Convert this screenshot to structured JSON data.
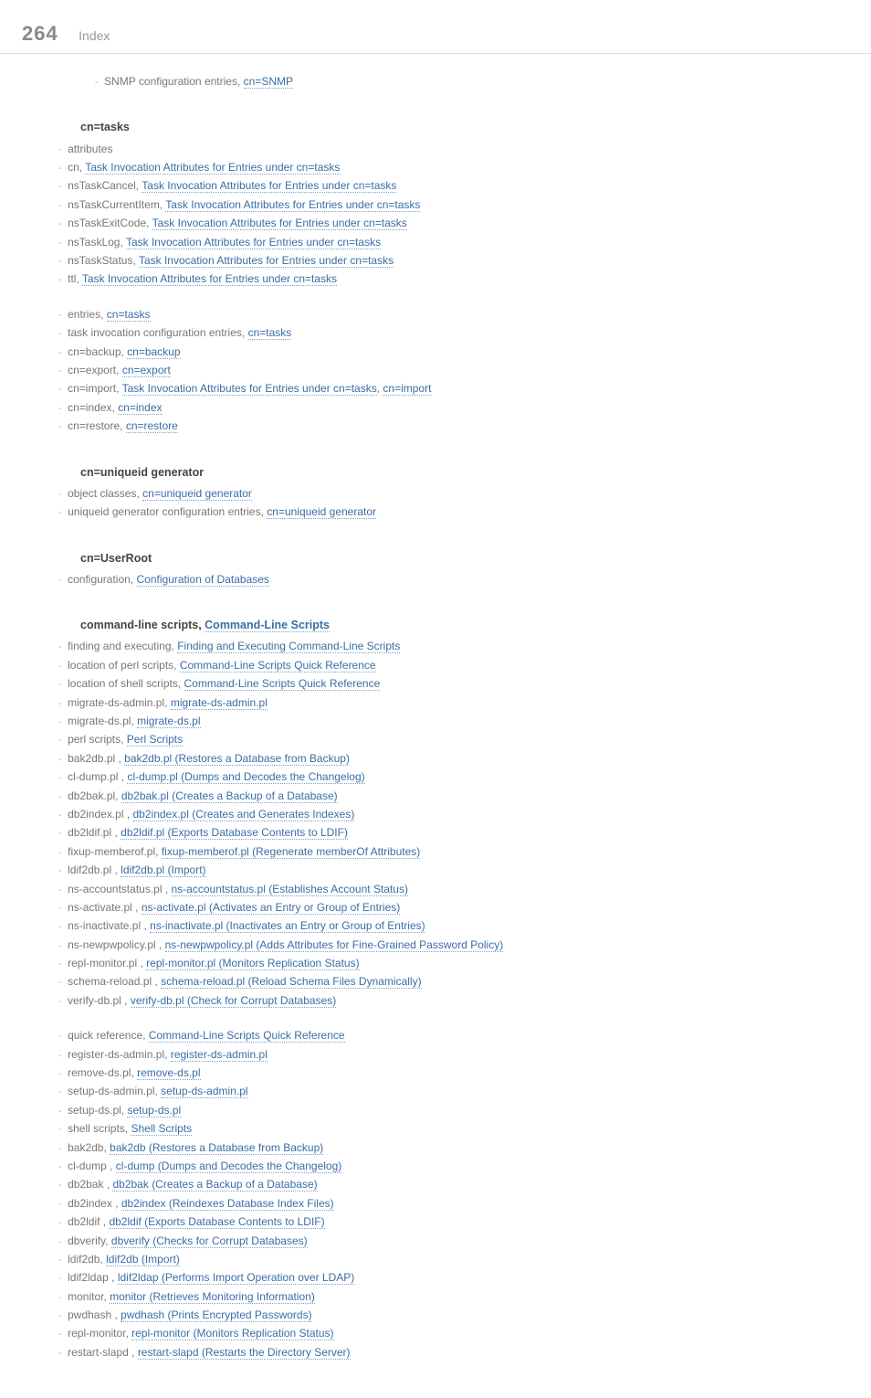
{
  "header": {
    "page_number": "264",
    "section": "Index"
  },
  "pre_section": {
    "items": [
      {
        "plain": "SNMP configuration entries, ",
        "link": "cn=SNMP"
      }
    ]
  },
  "sections": [
    {
      "title": "cn=tasks",
      "items": [
        {
          "lvl": 0,
          "plain": "attributes",
          "children": [
            {
              "plain": "cn, ",
              "link": "Task Invocation Attributes for Entries under cn=tasks"
            },
            {
              "plain": "nsTaskCancel, ",
              "link": "Task Invocation Attributes for Entries under cn=tasks"
            },
            {
              "plain": "nsTaskCurrentItem, ",
              "link": "Task Invocation Attributes for Entries under cn=tasks"
            },
            {
              "plain": "nsTaskExitCode, ",
              "link": "Task Invocation Attributes for Entries under cn=tasks"
            },
            {
              "plain": "nsTaskLog, ",
              "link": "Task Invocation Attributes for Entries under cn=tasks"
            },
            {
              "plain": "nsTaskStatus, ",
              "link": "Task Invocation Attributes for Entries under cn=tasks"
            },
            {
              "plain": "ttl, ",
              "link": "Task Invocation Attributes for Entries under cn=tasks"
            }
          ]
        },
        {
          "lvl": 0,
          "plain": "entries, ",
          "link": "cn=tasks",
          "gap_before": true
        },
        {
          "lvl": 0,
          "plain": "task invocation configuration entries, ",
          "link": "cn=tasks",
          "children": [
            {
              "plain": "cn=backup, ",
              "link": "cn=backup"
            },
            {
              "plain": "cn=export, ",
              "link": "cn=export"
            },
            {
              "plain": "cn=import, ",
              "link": "Task Invocation Attributes for Entries under cn=tasks",
              "sep2": ", ",
              "link2": "cn=import"
            },
            {
              "plain": "cn=index, ",
              "link": "cn=index"
            },
            {
              "plain": "cn=restore, ",
              "link": "cn=restore"
            }
          ]
        }
      ]
    },
    {
      "title": "cn=uniqueid generator",
      "items": [
        {
          "lvl": 0,
          "plain": "object classes, ",
          "link": "cn=uniqueid generator"
        },
        {
          "lvl": 0,
          "plain": "uniqueid generator configuration entries, ",
          "link": "cn=uniqueid generator"
        }
      ]
    },
    {
      "title": "cn=UserRoot",
      "items": [
        {
          "lvl": 0,
          "plain": "configuration, ",
          "link": "Configuration of Databases"
        }
      ]
    },
    {
      "title_plain": "command-line scripts, ",
      "title_link": "Command-Line Scripts",
      "items": [
        {
          "lvl": 0,
          "plain": "finding and executing, ",
          "link": "Finding and Executing Command-Line Scripts"
        },
        {
          "lvl": 0,
          "plain": "location of perl scripts, ",
          "link": "Command-Line Scripts Quick Reference"
        },
        {
          "lvl": 0,
          "plain": "location of shell scripts, ",
          "link": "Command-Line Scripts Quick Reference"
        },
        {
          "lvl": 0,
          "plain": "migrate-ds-admin.pl, ",
          "link": "migrate-ds-admin.pl"
        },
        {
          "lvl": 0,
          "plain": "migrate-ds.pl, ",
          "link": "migrate-ds.pl"
        },
        {
          "lvl": 0,
          "plain": "perl scripts, ",
          "link": "Perl Scripts",
          "children": [
            {
              "plain": "bak2db.pl , ",
              "link": "bak2db.pl (Restores a Database from Backup)"
            },
            {
              "plain": "cl-dump.pl , ",
              "link": "cl-dump.pl (Dumps and Decodes the Changelog)"
            },
            {
              "plain": "db2bak.pl, ",
              "link": "db2bak.pl (Creates a Backup of a Database)"
            },
            {
              "plain": "db2index.pl , ",
              "link": "db2index.pl (Creates and Generates Indexes)"
            },
            {
              "plain": "db2ldif.pl , ",
              "link": "db2ldif.pl (Exports Database Contents to LDIF)"
            },
            {
              "plain": "fixup-memberof.pl, ",
              "link": "fixup-memberof.pl (Regenerate memberOf Attributes)"
            },
            {
              "plain": "ldif2db.pl , ",
              "link": "ldif2db.pl (Import)"
            },
            {
              "plain": "ns-accountstatus.pl , ",
              "link": "ns-accountstatus.pl (Establishes Account Status)"
            },
            {
              "plain": "ns-activate.pl , ",
              "link": "ns-activate.pl (Activates an Entry or Group of Entries)"
            },
            {
              "plain": "ns-inactivate.pl , ",
              "link": "ns-inactivate.pl (Inactivates an Entry or Group of Entries)"
            },
            {
              "plain": "ns-newpwpolicy.pl , ",
              "link": "ns-newpwpolicy.pl (Adds Attributes for Fine-Grained Password Policy)",
              "wrap": true
            },
            {
              "plain": "repl-monitor.pl , ",
              "link": "repl-monitor.pl (Monitors Replication Status)"
            },
            {
              "plain": "schema-reload.pl , ",
              "link": "schema-reload.pl (Reload Schema Files Dynamically)"
            },
            {
              "plain": "verify-db.pl , ",
              "link": "verify-db.pl (Check for Corrupt Databases)"
            }
          ]
        },
        {
          "lvl": 0,
          "plain": "quick reference, ",
          "link": "Command-Line Scripts Quick Reference",
          "gap_before": true
        },
        {
          "lvl": 0,
          "plain": "register-ds-admin.pl, ",
          "link": "register-ds-admin.pl"
        },
        {
          "lvl": 0,
          "plain": "remove-ds.pl, ",
          "link": "remove-ds.pl"
        },
        {
          "lvl": 0,
          "plain": "setup-ds-admin.pl, ",
          "link": "setup-ds-admin.pl"
        },
        {
          "lvl": 0,
          "plain": "setup-ds.pl, ",
          "link": "setup-ds.pl"
        },
        {
          "lvl": 0,
          "plain": "shell scripts, ",
          "link": "Shell Scripts",
          "children": [
            {
              "plain": "bak2db, ",
              "link": "bak2db (Restores a Database from Backup)"
            },
            {
              "plain": "cl-dump , ",
              "link": "cl-dump (Dumps and Decodes the Changelog)"
            },
            {
              "plain": "db2bak , ",
              "link": "db2bak (Creates a Backup of a Database)"
            },
            {
              "plain": "db2index , ",
              "link": "db2index (Reindexes Database Index Files)"
            },
            {
              "plain": "db2ldif , ",
              "link": "db2ldif (Exports Database Contents to LDIF)"
            },
            {
              "plain": "dbverify, ",
              "link": "dbverify (Checks for Corrupt Databases)"
            },
            {
              "plain": "ldif2db, ",
              "link": "ldif2db (Import)"
            },
            {
              "plain": "ldif2ldap , ",
              "link": "ldif2ldap (Performs Import Operation over LDAP)"
            },
            {
              "plain": "monitor, ",
              "link": "monitor (Retrieves Monitoring Information)"
            },
            {
              "plain": "pwdhash , ",
              "link": "pwdhash (Prints Encrypted Passwords)"
            },
            {
              "plain": "repl-monitor, ",
              "link": "repl-monitor (Monitors Replication Status)"
            },
            {
              "plain": "restart-slapd , ",
              "link": "restart-slapd (Restarts the Directory Server)"
            }
          ]
        }
      ]
    }
  ]
}
